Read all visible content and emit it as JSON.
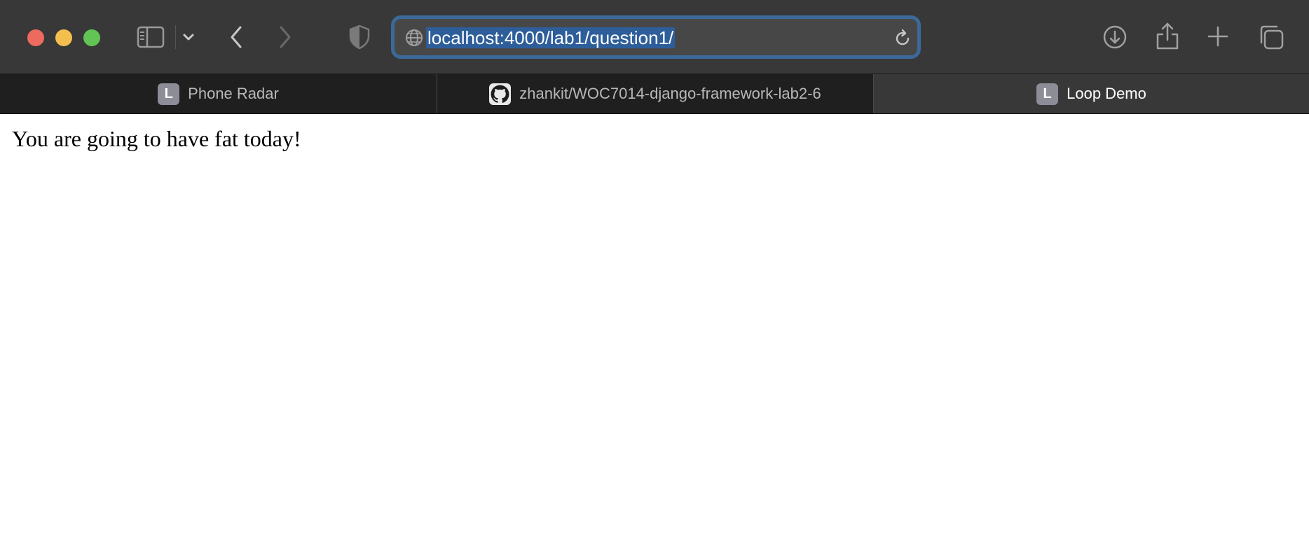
{
  "browser": {
    "address_bar": {
      "url": "localhost:4000/lab1/question1/"
    },
    "toolbar_icons": {
      "sidebar": "sidebar-icon",
      "sidebar_menu": "chevron-down-icon",
      "back": "chevron-left-icon",
      "forward": "chevron-right-icon",
      "privacy": "shield-icon",
      "site": "globe-icon",
      "reload": "reload-icon",
      "downloads": "download-icon",
      "share": "share-icon",
      "new_tab": "plus-icon",
      "tab_overview": "tabs-overview-icon"
    },
    "tabs": [
      {
        "title": "Phone Radar",
        "favicon_letter": "L",
        "active": false
      },
      {
        "title": "zhankit/WOC7014-django-framework-lab2-6",
        "favicon": "github-icon",
        "active": false
      },
      {
        "title": "Loop Demo",
        "favicon_letter": "L",
        "active": true
      }
    ]
  },
  "page": {
    "message": "You are going to have fat today!"
  }
}
